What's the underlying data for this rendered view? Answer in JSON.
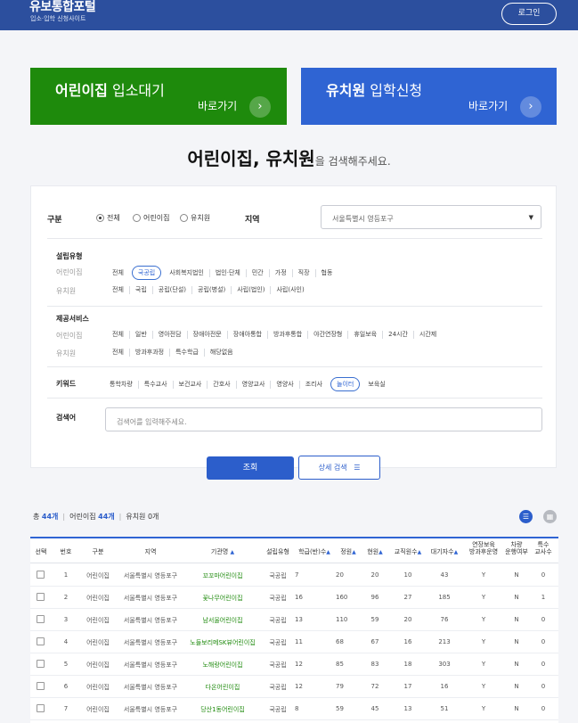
{
  "header": {
    "brand": "유보통합포털",
    "brand_sub": "입소·입학 신청사이트",
    "login": "로그인"
  },
  "cards": [
    {
      "strong": "어린이집",
      "rest": " 입소대기",
      "go": "바로가기"
    },
    {
      "strong": "유치원",
      "rest": " 입학신청",
      "go": "바로가기"
    }
  ],
  "headline": {
    "strong": "어린이집, 유치원",
    "rest": "을 검색해주세요."
  },
  "search": {
    "type_label": "구분",
    "type_options": [
      "전체",
      "어린이집",
      "유치원"
    ],
    "region_label": "지역",
    "region_value": "서울특별시 영등포구",
    "est_label": "설립유형",
    "est_daycare_label": "어린이집",
    "est_daycare": [
      "전체",
      "국공립",
      "사회복지법인",
      "법인·단체",
      "민간",
      "가정",
      "직장",
      "협동"
    ],
    "est_kinder_label": "유치원",
    "est_kinder": [
      "전체",
      "국립",
      "공립(단설)",
      "공립(병설)",
      "사립(법인)",
      "사립(사인)"
    ],
    "svc_label": "제공서비스",
    "svc_daycare_label": "어린이집",
    "svc_daycare": [
      "전체",
      "일반",
      "영아전담",
      "장애아전문",
      "장애아통합",
      "방과후통합",
      "야간연장형",
      "휴일보육",
      "24시간",
      "시간제"
    ],
    "svc_kinder_label": "유치원",
    "svc_kinder": [
      "전체",
      "방과후과정",
      "특수학급",
      "해당없음"
    ],
    "kw_label": "키워드",
    "keywords": [
      "통학차량",
      "특수교사",
      "보건교사",
      "간호사",
      "영양교사",
      "영양사",
      "조리사",
      "놀이터",
      "보육실"
    ],
    "query_label": "검색어",
    "query_placeholder": "검색어를 입력해주세요.",
    "btn_search": "조회",
    "btn_detail": "상세 검색"
  },
  "summary": {
    "total_label": "총",
    "total": "44개",
    "dc_label": "어린이집",
    "dc": "44개",
    "kg_label": "유치원",
    "kg": "0개"
  },
  "table": {
    "headers": [
      "선택",
      "번호",
      "구분",
      "지역",
      "기관명",
      "설립유형",
      "학급(반)수",
      "정원",
      "현원",
      "교직원수",
      "대기자수",
      "연장보육\n방과후운영",
      "차량\n운행여부",
      "특수\n교사수"
    ],
    "rows": [
      [
        "1",
        "어린이집",
        "서울특별시 영등포구",
        "꼬꼬마어린이집",
        "국공립",
        "7",
        "20",
        "20",
        "10",
        "43",
        "Y",
        "N",
        "0"
      ],
      [
        "2",
        "어린이집",
        "서울특별시 영등포구",
        "꽃나무어린이집",
        "국공립",
        "16",
        "160",
        "96",
        "27",
        "185",
        "Y",
        "N",
        "1"
      ],
      [
        "3",
        "어린이집",
        "서울특별시 영등포구",
        "남서울어린이집",
        "국공립",
        "13",
        "110",
        "59",
        "20",
        "76",
        "Y",
        "N",
        "0"
      ],
      [
        "4",
        "어린이집",
        "서울특별시 영등포구",
        "노들보리메SK뷰어린이집",
        "국공립",
        "11",
        "68",
        "67",
        "16",
        "213",
        "Y",
        "N",
        "0"
      ],
      [
        "5",
        "어린이집",
        "서울특별시 영등포구",
        "노해랑어린이집",
        "국공립",
        "12",
        "85",
        "83",
        "18",
        "303",
        "Y",
        "N",
        "0"
      ],
      [
        "6",
        "어린이집",
        "서울특별시 영등포구",
        "다온어린이집",
        "국공립",
        "12",
        "79",
        "72",
        "17",
        "16",
        "Y",
        "N",
        "0"
      ],
      [
        "7",
        "어린이집",
        "서울특별시 영등포구",
        "당산1동어린이집",
        "국공립",
        "8",
        "59",
        "45",
        "13",
        "51",
        "Y",
        "N",
        "0"
      ]
    ]
  }
}
